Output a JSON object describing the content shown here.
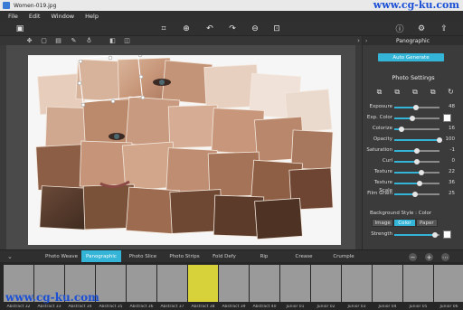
{
  "window": {
    "title": "Women-019.jpg",
    "watermark": "www.cg-ku.com"
  },
  "menu": [
    "File",
    "Edit",
    "Window",
    "Help"
  ],
  "panel": {
    "title": "Panographic",
    "auto_generate": "Auto Generate",
    "photo_settings": "Photo Settings",
    "sliders": [
      {
        "label": "Exposure",
        "value": "48",
        "fraction": 0.48
      },
      {
        "label": "Exp. Color",
        "value": "",
        "fraction": 0.4,
        "swatch": true
      },
      {
        "label": "Colorize",
        "value": "16",
        "fraction": 0.16
      },
      {
        "label": "Opacity",
        "value": "100",
        "fraction": 1.0
      },
      {
        "label": "Saturation",
        "value": "-1",
        "fraction": 0.49
      },
      {
        "label": "Curl",
        "value": "0",
        "fraction": 0.5
      },
      {
        "label": "Texture",
        "value": "22",
        "fraction": 0.6
      },
      {
        "label": "Texture Scale",
        "value": "36",
        "fraction": 0.55
      },
      {
        "label": "Film Grain",
        "value": "25",
        "fraction": 0.45
      }
    ],
    "background_label": "Background Style : Color",
    "bg_options": [
      "Image",
      "Color",
      "Paper"
    ],
    "bg_active": "Color",
    "strength": {
      "label": "Strength",
      "fraction": 0.9
    }
  },
  "bottom_tabs": [
    "Photo Weave",
    "Panographic",
    "Photo Slice",
    "Photo Strips",
    "Fold Defy",
    "Rip",
    "Crease",
    "Crumple"
  ],
  "bottom_active": "Panographic",
  "thumbnails": [
    "Abstract 32",
    "Abstract 33",
    "Abstract 34",
    "Abstract 35",
    "Abstract 36",
    "Abstract 37",
    "Abstract 38",
    "Abstract 39",
    "Abstract 40",
    "Junior 01",
    "Junior 02",
    "Junior 03",
    "Junior 04",
    "Junior 05",
    "Junior 06"
  ],
  "thumb_selected_index": 6,
  "colors": {
    "accent": "#34b4d6",
    "watermark": "#1a4fd6"
  },
  "icons": {
    "toolbar_left": [
      "image-icon"
    ],
    "toolbar_center": [
      "crop-icon",
      "zoom-in-icon",
      "rotate-left-icon",
      "rotate-right-icon",
      "zoom-out-icon",
      "fit-icon"
    ],
    "toolbar_right": [
      "info-icon",
      "settings-icon",
      "share-icon"
    ]
  }
}
